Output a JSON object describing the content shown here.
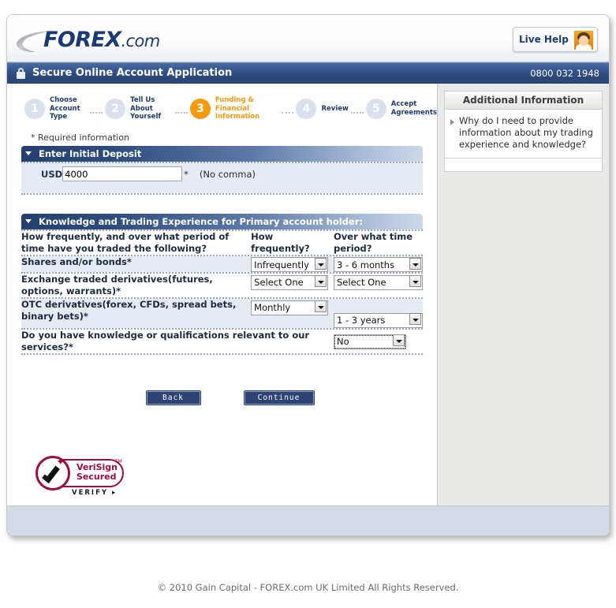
{
  "brand": {
    "name": "FOREX",
    "suffix": ".com",
    "swoosh_icon": "swoosh-icon"
  },
  "live_help": {
    "label": "Live Help",
    "avatar_icon": "agent-avatar-icon"
  },
  "secure_bar": {
    "lock_icon": "lock-icon",
    "title": "Secure Online Account Application",
    "phone": "0800 032 1948"
  },
  "steps": [
    {
      "number": "1",
      "label": "Choose\nAccount Type",
      "active": false
    },
    {
      "number": "2",
      "label": "Tell Us\nAbout Yourself",
      "active": false
    },
    {
      "number": "3",
      "label": "Funding &\nFinancial Information",
      "active": true
    },
    {
      "number": "4",
      "label": "Review",
      "active": false
    },
    {
      "number": "5",
      "label": "Accept\nAgreements",
      "active": false
    }
  ],
  "form": {
    "required_note": "* Required information",
    "deposit_section": {
      "title": "Enter Initial Deposit",
      "collapse_icon": "chevron-down-icon",
      "currency_label": "USD",
      "amount_value": "4000",
      "amount_placeholder": "",
      "required_star": "*",
      "hint": "(No comma)"
    },
    "knowledge_section": {
      "title": "Knowledge and Trading Experience for Primary account holder:",
      "collapse_icon": "chevron-down-icon",
      "column_headers": [
        "How frequently, and over what period of time have you traded the following?",
        "How frequently?",
        "Over what time period?"
      ],
      "rows": [
        {
          "question": "Shares and/or bonds*",
          "frequency_value": "Infrequently",
          "period_value": "3 - 6 months"
        },
        {
          "question": "Exchange traded derivatives(futures, options, warrants)*",
          "frequency_value": "Select One",
          "period_value": "Select One"
        },
        {
          "question": "OTC derivatives(forex, CFDs, spread bets, binary bets)*",
          "frequency_value": "Monthly",
          "period_value": "1 - 3 years"
        }
      ],
      "qualification_question": "Do you have knowledge or qualifications relevant to our services?*",
      "qualification_value": "No"
    },
    "buttons": {
      "back": "Back",
      "continue": "Continue"
    }
  },
  "verisign": {
    "line1": "VeriSign",
    "line2": "Secured",
    "tm": "TM",
    "verify": "VERIFY",
    "check_icon": "checkmark-icon"
  },
  "sidebar": {
    "title": "Additional Information",
    "items": [
      {
        "bullet_icon": "triangle-right-icon",
        "label": "Why do I need to provide information about my trading experience and knowledge?"
      }
    ]
  },
  "footer": {
    "copyright": "© 2010 Gain Capital - FOREX.com UK Limited All Rights Reserved."
  }
}
